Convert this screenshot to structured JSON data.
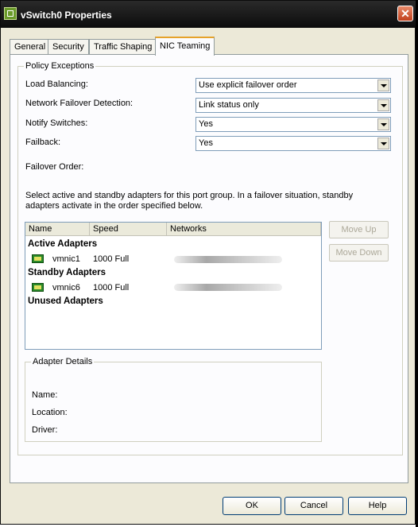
{
  "window": {
    "title": "vSwitch0 Properties"
  },
  "tabs": [
    {
      "label": "General"
    },
    {
      "label": "Security"
    },
    {
      "label": "Traffic Shaping"
    },
    {
      "label": "NIC Teaming"
    }
  ],
  "policy": {
    "group_label": "Policy Exceptions",
    "load_balancing": {
      "label": "Load Balancing:",
      "value": "Use explicit failover order"
    },
    "failover_detection": {
      "label": "Network Failover Detection:",
      "value": "Link status only"
    },
    "notify_switches": {
      "label": "Notify Switches:",
      "value": "Yes"
    },
    "failback": {
      "label": "Failback:",
      "value": "Yes"
    },
    "failover_order_label": "Failover Order:",
    "description": "Select active and standby adapters for this port group.  In a failover situation, standby adapters activate  in the order specified below."
  },
  "adapters": {
    "columns": [
      "Name",
      "Speed",
      "Networks"
    ],
    "sections": {
      "active": "Active Adapters",
      "standby": "Standby Adapters",
      "unused": "Unused Adapters"
    },
    "active": [
      {
        "name": "vmnic1",
        "speed": "1000 Full"
      }
    ],
    "standby": [
      {
        "name": "vmnic6",
        "speed": "1000 Full"
      }
    ]
  },
  "side_buttons": {
    "move_up": "Move Up",
    "move_down": "Move Down"
  },
  "details": {
    "group_label": "Adapter Details",
    "name_label": "Name:",
    "location_label": "Location:",
    "driver_label": "Driver:"
  },
  "footer": {
    "ok": "OK",
    "cancel": "Cancel",
    "help": "Help"
  },
  "colors": {
    "active_tab_accent": "#e6a22a",
    "titlebar": "#0c0c0c",
    "dialog_bg": "#ece9d8"
  }
}
